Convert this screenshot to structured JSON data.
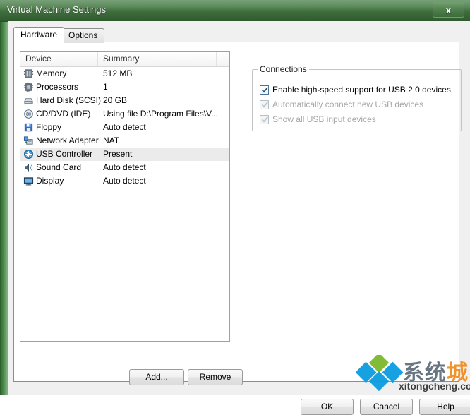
{
  "window": {
    "title": "Virtual Machine Settings",
    "close_label": "x"
  },
  "tabs": [
    {
      "label": "Hardware",
      "active": true
    },
    {
      "label": "Options",
      "active": false
    }
  ],
  "device_list": {
    "columns": [
      "Device",
      "Summary"
    ],
    "rows": [
      {
        "icon": "memory-icon",
        "device": "Memory",
        "summary": "512 MB",
        "selected": false
      },
      {
        "icon": "processor-icon",
        "device": "Processors",
        "summary": "1",
        "selected": false
      },
      {
        "icon": "hard-disk-icon",
        "device": "Hard Disk (SCSI)",
        "summary": "20 GB",
        "selected": false
      },
      {
        "icon": "cd-dvd-icon",
        "device": "CD/DVD (IDE)",
        "summary": "Using file D:\\Program Files\\V...",
        "selected": false
      },
      {
        "icon": "floppy-icon",
        "device": "Floppy",
        "summary": "Auto detect",
        "selected": false
      },
      {
        "icon": "network-adapter-icon",
        "device": "Network Adapter",
        "summary": "NAT",
        "selected": false
      },
      {
        "icon": "usb-controller-icon",
        "device": "USB Controller",
        "summary": "Present",
        "selected": true
      },
      {
        "icon": "sound-card-icon",
        "device": "Sound Card",
        "summary": "Auto detect",
        "selected": false
      },
      {
        "icon": "display-icon",
        "device": "Display",
        "summary": "Auto detect",
        "selected": false
      }
    ]
  },
  "list_buttons": {
    "add": "Add...",
    "remove": "Remove"
  },
  "connections": {
    "title": "Connections",
    "checkboxes": [
      {
        "label": "Enable high-speed support for USB 2.0 devices",
        "checked": true,
        "enabled": true
      },
      {
        "label": "Automatically connect new USB devices",
        "checked": true,
        "enabled": false
      },
      {
        "label": "Show all USB input devices",
        "checked": true,
        "enabled": false
      }
    ]
  },
  "footer": {
    "ok": "OK",
    "cancel": "Cancel",
    "help": "Help"
  },
  "watermark": {
    "text_cn_a": "系统",
    "text_cn_b": "城",
    "text_en": "xitongcheng.com"
  },
  "colors": {
    "titlebar_green": "#4e7f4c",
    "selection": "#ebebeb",
    "checkbox_border": "#4f7396",
    "accent_orange": "#f08a1c"
  }
}
